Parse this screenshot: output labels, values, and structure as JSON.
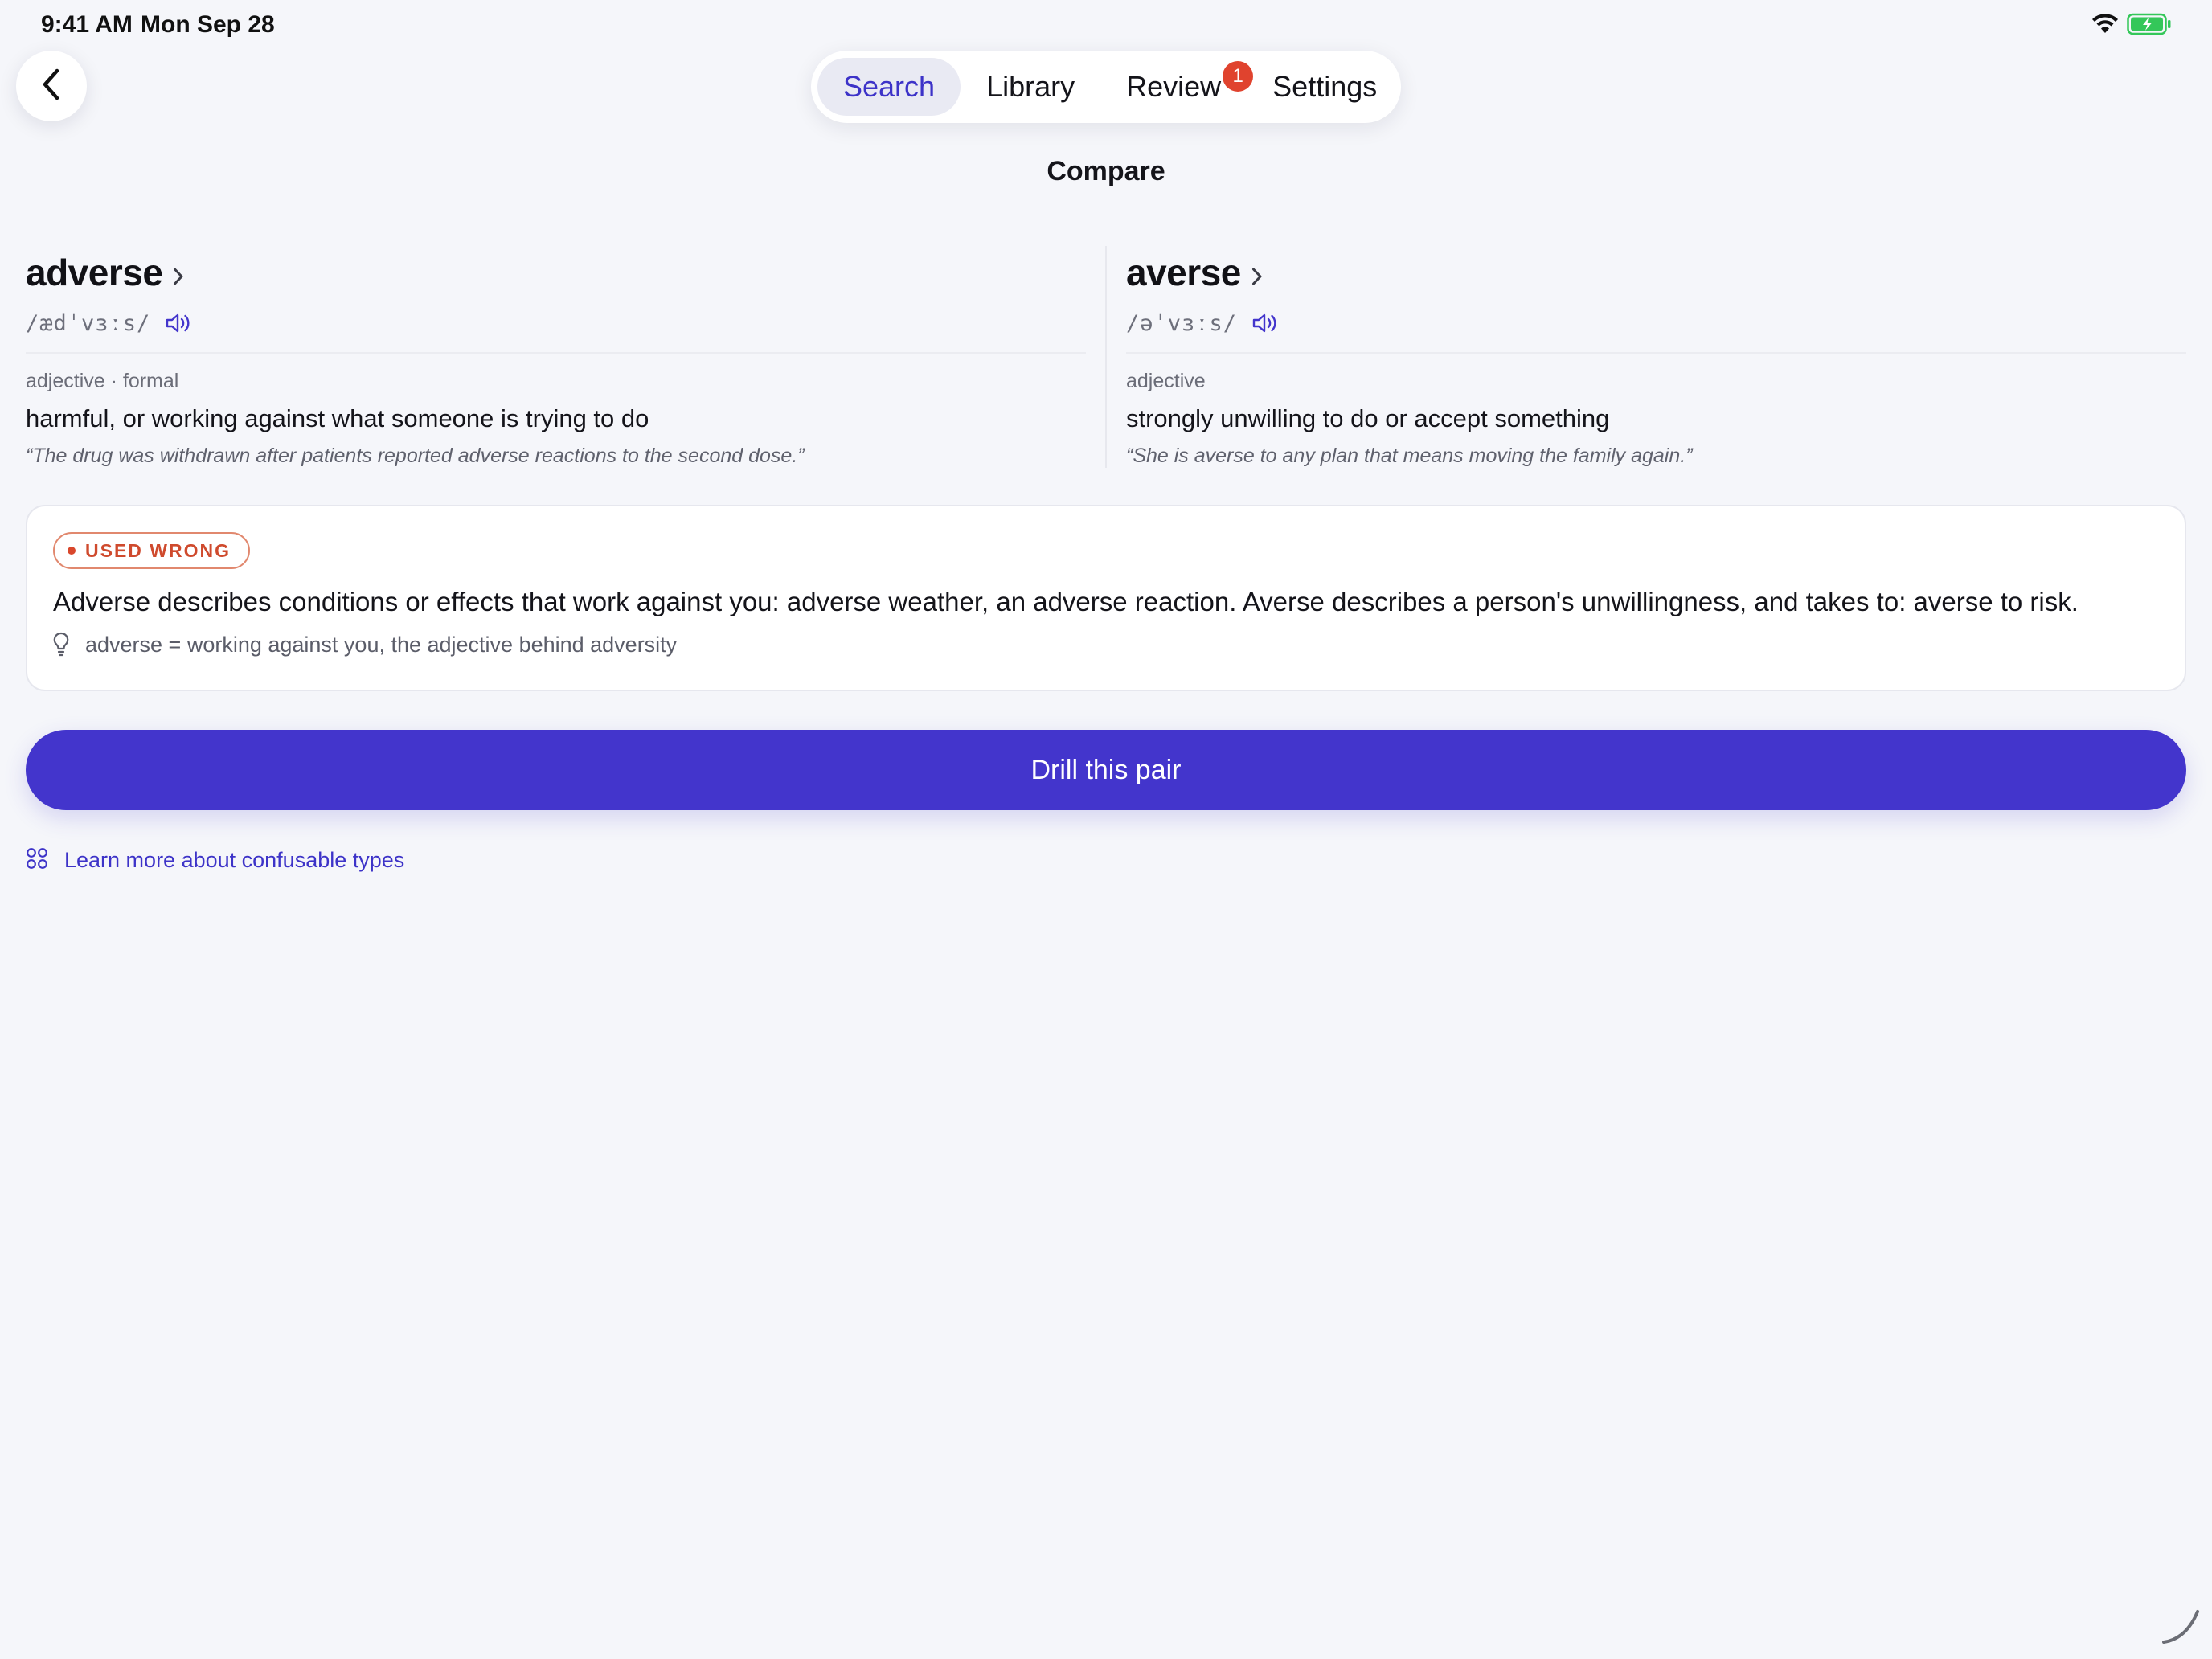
{
  "status_bar": {
    "time": "9:41 AM",
    "date": "Mon Sep 28"
  },
  "tabs": [
    {
      "label": "Search",
      "active": true
    },
    {
      "label": "Library",
      "active": false
    },
    {
      "label": "Review",
      "active": false,
      "badge": "1"
    },
    {
      "label": "Settings",
      "active": false
    }
  ],
  "page": {
    "title": "Compare"
  },
  "words": {
    "left": {
      "word": "adverse",
      "pronunciation": "/ædˈvɜːs/",
      "part_of_speech": "adjective · formal",
      "definition": "harmful, or working against what someone is trying to do",
      "example": "“The drug was withdrawn after patients reported adverse reactions to the second dose.”"
    },
    "right": {
      "word": "averse",
      "pronunciation": "/əˈvɜːs/",
      "part_of_speech": "adjective",
      "definition": "strongly unwilling to do or accept something",
      "example": "“She is averse to any plan that means moving the family again.”"
    }
  },
  "note": {
    "badge_label": "USED WRONG",
    "text": "Adverse describes conditions or effects that work against you: adverse weather, an adverse reaction. Averse describes a person's unwillingness, and takes to: averse to risk.",
    "tip": "adverse = working against you, the adjective behind adversity"
  },
  "actions": {
    "drill_label": "Drill this pair",
    "learn_more_label": "Learn more about confusable types"
  },
  "colors": {
    "accent": "#4335cc",
    "badge": "#e0432e",
    "warning": "#cf4a2d",
    "battery": "#34c759"
  },
  "icons": {
    "back": "chevron-left-icon",
    "word_link": "chevron-right-icon",
    "audio": "speaker-icon",
    "tip": "lightbulb-icon",
    "learn": "grid-icon",
    "wifi": "wifi-icon",
    "battery": "battery-charging-icon"
  }
}
